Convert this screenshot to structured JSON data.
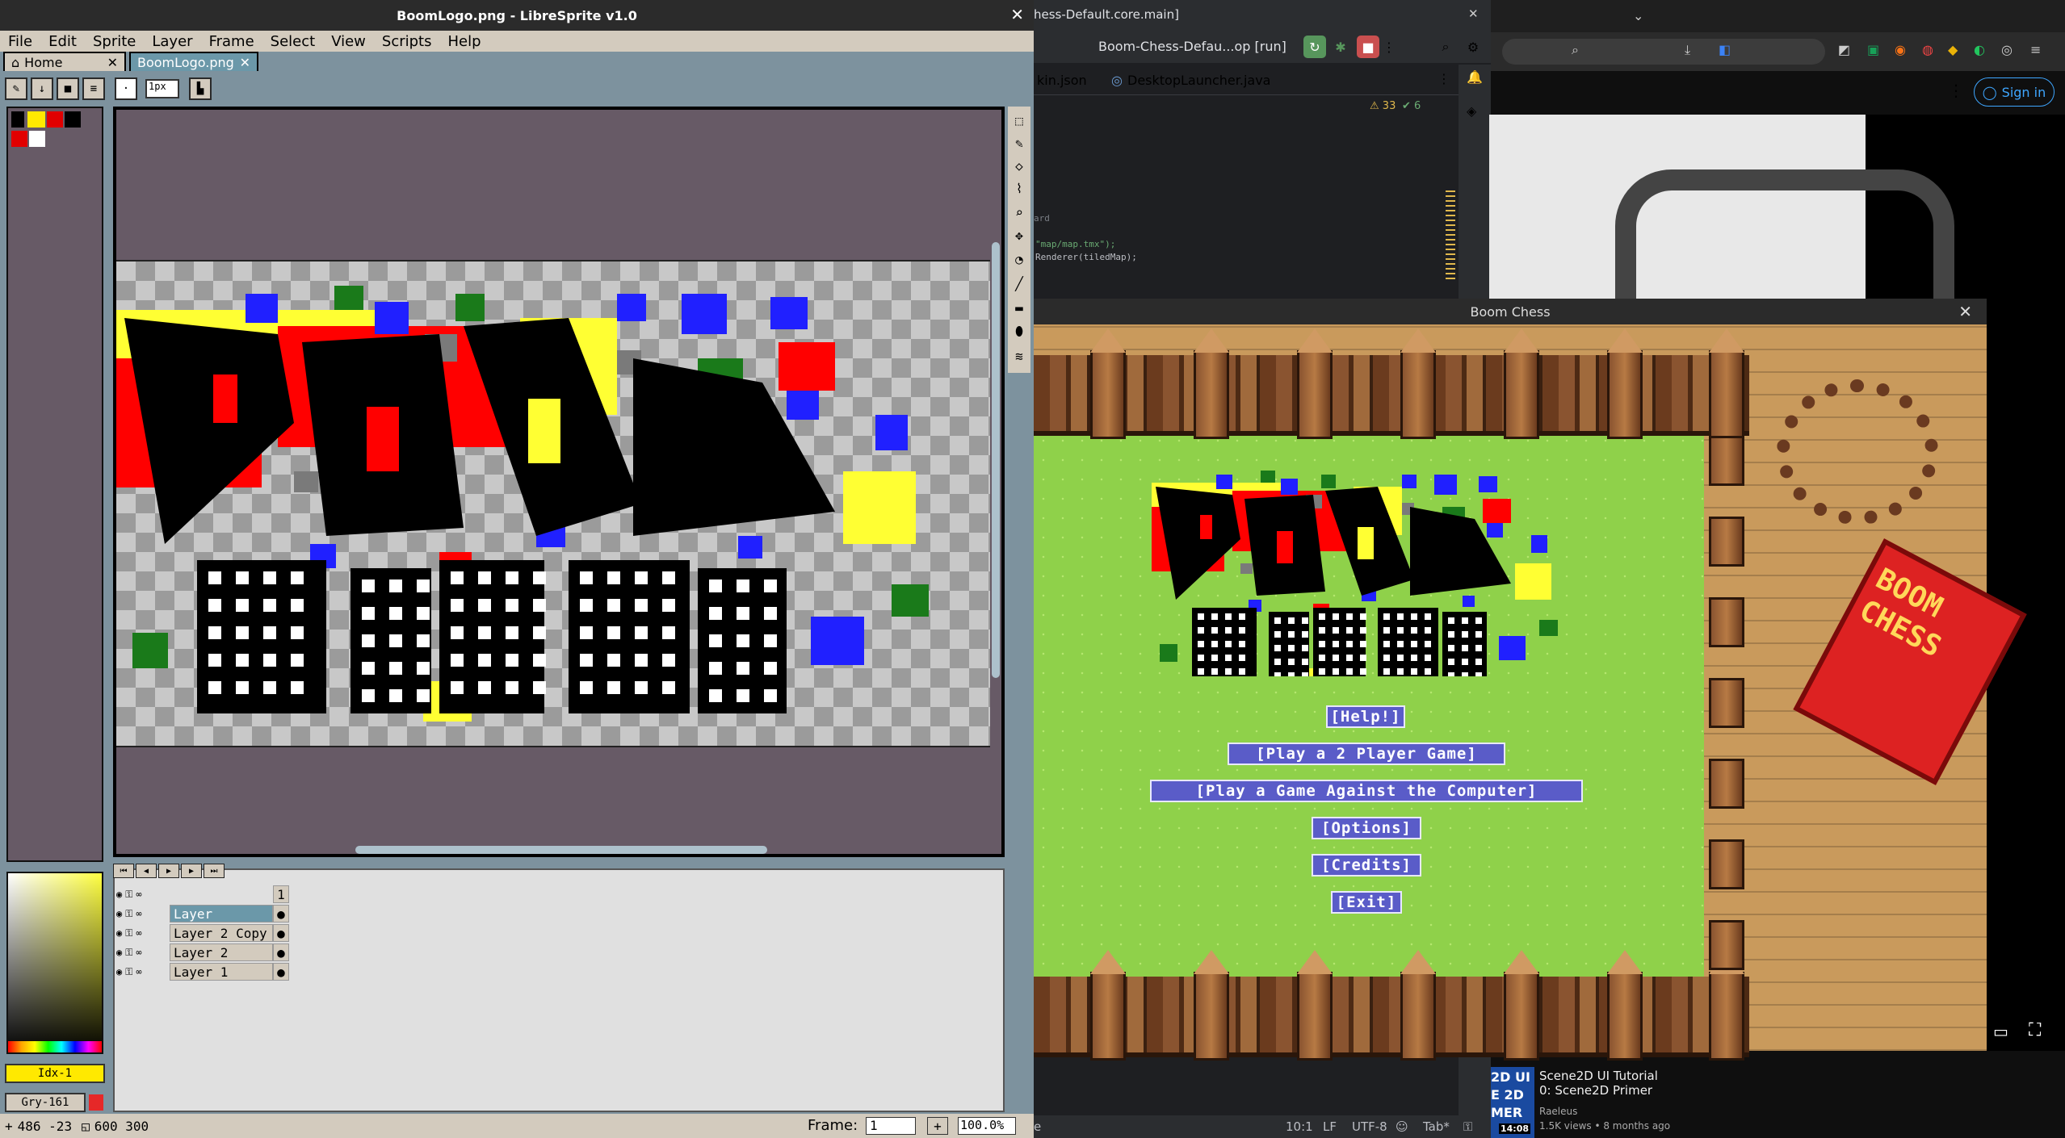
{
  "libresprite": {
    "window_title": "BoomLogo.png - LibreSprite v1.0",
    "menu": [
      "File",
      "Edit",
      "Sprite",
      "Layer",
      "Frame",
      "Select",
      "View",
      "Scripts",
      "Help"
    ],
    "tabs": [
      {
        "label": "Home"
      },
      {
        "label": "BoomLogo.png"
      }
    ],
    "brush_size": "1px",
    "layers": [
      {
        "name": "",
        "cel": "1"
      },
      {
        "name": "Layer",
        "cel": ""
      },
      {
        "name": "Layer 2 Copy",
        "cel": ""
      },
      {
        "name": "Layer 2",
        "cel": ""
      },
      {
        "name": "Layer 1",
        "cel": ""
      }
    ],
    "color_index": "Idx-1",
    "gray_value": "Gry-161",
    "status": {
      "cursor": "486 -23",
      "size": "600 300",
      "frame_label": "Frame:",
      "frame_value": "1",
      "zoom": "100.0%"
    }
  },
  "ide": {
    "title_fragment": "hess-Default.core.main]",
    "run_config": "Boom-Chess-Defau...op [run]",
    "tabs": [
      "kin.json",
      "DesktopLauncher.java"
    ],
    "inspections": {
      "warnings": "33",
      "checks": "6"
    },
    "code_lines": [
      "ard",
      "\"map/map.tmx\");",
      "Renderer(tiledMap);"
    ],
    "status": {
      "position": "10:1",
      "line_sep": "LF",
      "encoding": "UTF-8",
      "indent": "Tab*"
    }
  },
  "browser": {
    "signin_label": "Sign in",
    "video": {
      "title": "Scene2D UI Tutorial 0: Scene2D Primer",
      "channel": "Raeleus",
      "meta": "1.5K views • 8 months ago",
      "duration": "14:08",
      "thumb_text": "2D UI\nE 2D\nMER"
    }
  },
  "game": {
    "window_title": "Boom Chess",
    "logo_top": "BOOM",
    "logo_bottom": "CHESS",
    "buttons": [
      {
        "label": "[Help!]"
      },
      {
        "label": "[Play a 2 Player Game]"
      },
      {
        "label": "[Play a Game Against the Computer]"
      },
      {
        "label": "[Options]"
      },
      {
        "label": "[Credits]"
      },
      {
        "label": "[Exit]"
      }
    ],
    "box_text": "BOOM CHESS"
  },
  "colors": {
    "palette": [
      "#000000",
      "#ffe900",
      "#e10000",
      "#000000",
      "#e10000",
      "#ffffff"
    ],
    "logo": {
      "red": "#ff0000",
      "yellow": "#ffff33",
      "blue": "#2020ff",
      "green": "#1a7a1a",
      "gray": "#7a7a7a"
    }
  }
}
